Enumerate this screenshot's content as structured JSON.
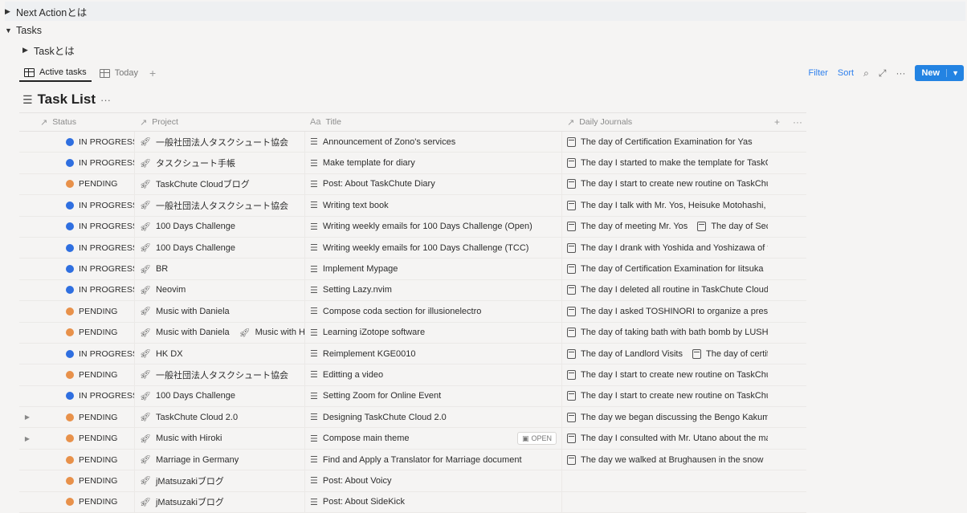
{
  "toggles": {
    "next_action": "Next Actionとは",
    "tasks": "Tasks",
    "task_wa": "Taskとは"
  },
  "views": {
    "active_tab": "Active tasks",
    "second_tab": "Today"
  },
  "toolbar": {
    "filter": "Filter",
    "sort": "Sort",
    "new_label": "New"
  },
  "database": {
    "title": "Task List"
  },
  "columns": {
    "status": "Status",
    "project": "Project",
    "title": "Title",
    "journals": "Daily Journals",
    "title_prefix": "Aa"
  },
  "colors": {
    "in_progress": "#2f6fe0",
    "pending": "#e8914a",
    "accent": "#2383e2"
  },
  "rows": [
    {
      "status": "IN PROGRESS",
      "project": "一般社団法人タスクシュート協会",
      "project2": "",
      "title": "Announcement of Zono's services",
      "journal": "The day of Certification Examination for Yas",
      "journal2": "",
      "expand": false
    },
    {
      "status": "IN PROGRESS",
      "project": "タスクシュート手帳",
      "project2": "",
      "title": "Make template for diary",
      "journal": "The day I started to make the template for TaskCh",
      "journal2": "",
      "expand": false
    },
    {
      "status": "PENDING",
      "project": "TaskChute Cloudブログ",
      "project2": "",
      "title": "Post: About TaskChute Diary",
      "journal": "The day I start to create new routine on TaskChute",
      "journal2": "",
      "expand": false
    },
    {
      "status": "IN PROGRESS",
      "project": "一般社団法人タスクシュート協会",
      "project2": "",
      "title": "Writing text book",
      "journal": "The day I talk with Mr. Yos, Heisuke Motohashi, Yu",
      "journal2": "",
      "expand": false
    },
    {
      "status": "IN PROGRESS",
      "project": "100 Days Challenge",
      "project2": "",
      "title": "Writing weekly emails for 100 Days Challenge (Open)",
      "journal": "The day of meeting Mr. Yos",
      "journal2": "The day of Secu",
      "expand": false
    },
    {
      "status": "IN PROGRESS",
      "project": "100 Days Challenge",
      "project2": "",
      "title": "Writing weekly emails for 100 Days Challenge (TCC)",
      "journal": "The day I drank with Yoshida and Yoshizawa of th",
      "journal2": "",
      "expand": false
    },
    {
      "status": "IN PROGRESS",
      "project": "BR",
      "project2": "",
      "title": "Implement Mypage",
      "journal": "The day of Certification Examination for Iitsuka",
      "journal2": "",
      "expand": false
    },
    {
      "status": "IN PROGRESS",
      "project": "Neovim",
      "project2": "",
      "title": "Setting Lazy.nvim",
      "journal": "The day I deleted all routine in TaskChute Cloud b",
      "journal2": "",
      "expand": false
    },
    {
      "status": "PENDING",
      "project": "Music with Daniela",
      "project2": "",
      "title": "Compose coda section for illusionelectro",
      "journal": "The day I asked TOSHINORI to organize a presen",
      "journal2": "",
      "expand": false
    },
    {
      "status": "PENDING",
      "project": "Music with Daniela",
      "project2": "Music with Hiro",
      "title": "Learning iZotope software",
      "journal": "The day of taking bath with bath bomb by LUSH",
      "journal2": "",
      "expand": false
    },
    {
      "status": "IN PROGRESS",
      "project": "HK DX",
      "project2": "",
      "title": "Reimplement KGE0010",
      "journal": "The day of Landlord Visits",
      "journal2": "The day of certifi",
      "expand": false
    },
    {
      "status": "PENDING",
      "project": "一般社団法人タスクシュート協会",
      "project2": "",
      "title": "Editting a video",
      "journal": "The day I start to create new routine on TaskChute",
      "journal2": "",
      "expand": false
    },
    {
      "status": "IN PROGRESS",
      "project": "100 Days Challenge",
      "project2": "",
      "title": "Setting Zoom for Online Event",
      "journal": "The day I start to create new routine on TaskChute",
      "journal2": "",
      "expand": false
    },
    {
      "status": "PENDING",
      "project": "TaskChute Cloud 2.0",
      "project2": "",
      "title": "Designing TaskChute Cloud 2.0",
      "journal": "The day we began discussing the Bengo Kakume",
      "journal2": "",
      "expand": true
    },
    {
      "status": "PENDING",
      "project": "Music with Hiroki",
      "project2": "",
      "title": "Compose main theme",
      "journal": "The day I consulted with Mr. Utano about the mar",
      "journal2": "",
      "expand": true,
      "open": "OPEN"
    },
    {
      "status": "PENDING",
      "project": "Marriage in Germany",
      "project2": "",
      "title": "Find and Apply a Translator for Marriage document",
      "journal": "The day we walked at Brughausen in the snow",
      "journal2": "",
      "expand": false
    },
    {
      "status": "PENDING",
      "project": "jMatsuzakiブログ",
      "project2": "",
      "title": "Post: About Voicy",
      "journal": "",
      "journal2": "",
      "expand": false
    },
    {
      "status": "PENDING",
      "project": "jMatsuzakiブログ",
      "project2": "",
      "title": "Post: About SideKick",
      "journal": "",
      "journal2": "",
      "expand": false
    }
  ]
}
